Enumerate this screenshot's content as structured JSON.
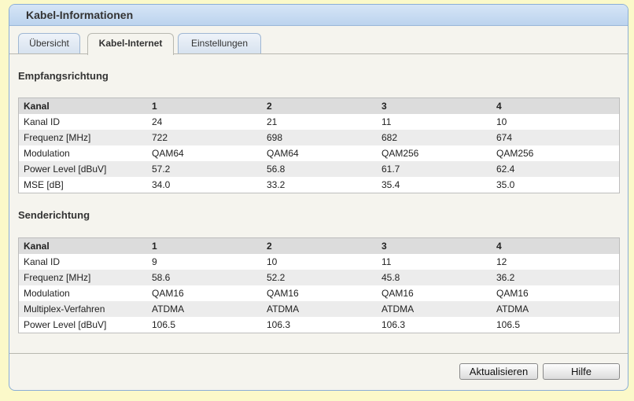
{
  "window": {
    "title": "Kabel-Informationen"
  },
  "tabs": [
    {
      "label": "Übersicht"
    },
    {
      "label": "Kabel-Internet"
    },
    {
      "label": "Einstellungen"
    }
  ],
  "downstream": {
    "title": "Empfangsrichtung",
    "header": [
      "Kanal",
      "1",
      "2",
      "3",
      "4"
    ],
    "rows": [
      [
        "Kanal ID",
        "24",
        "21",
        "11",
        "10"
      ],
      [
        "Frequenz [MHz]",
        "722",
        "698",
        "682",
        "674"
      ],
      [
        "Modulation",
        "QAM64",
        "QAM64",
        "QAM256",
        "QAM256"
      ],
      [
        "Power Level [dBuV]",
        "57.2",
        "56.8",
        "61.7",
        "62.4"
      ],
      [
        "MSE [dB]",
        "34.0",
        "33.2",
        "35.4",
        "35.0"
      ]
    ]
  },
  "upstream": {
    "title": "Senderichtung",
    "header": [
      "Kanal",
      "1",
      "2",
      "3",
      "4"
    ],
    "rows": [
      [
        "Kanal ID",
        "9",
        "10",
        "11",
        "12"
      ],
      [
        "Frequenz [MHz]",
        "58.6",
        "52.2",
        "45.8",
        "36.2"
      ],
      [
        "Modulation",
        "QAM16",
        "QAM16",
        "QAM16",
        "QAM16"
      ],
      [
        "Multiplex-Verfahren",
        "ATDMA",
        "ATDMA",
        "ATDMA",
        "ATDMA"
      ],
      [
        "Power Level [dBuV]",
        "106.5",
        "106.3",
        "106.3",
        "106.5"
      ]
    ]
  },
  "buttons": {
    "refresh_label": "Aktualisieren",
    "help_label": "Hilfe"
  }
}
